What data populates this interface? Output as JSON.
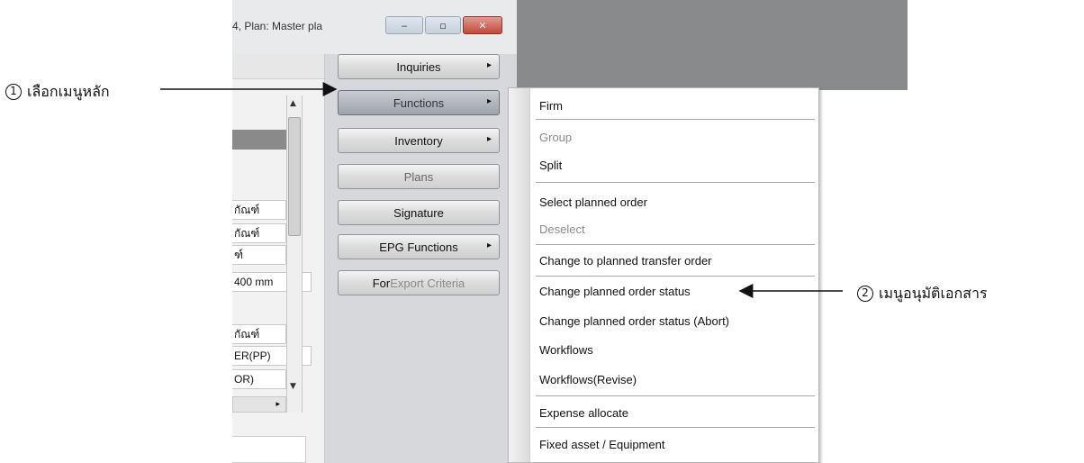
{
  "window": {
    "title": "4, Plan: Master pla",
    "controls": {
      "minimize": "‒",
      "maximize": "▫",
      "close": "✕"
    }
  },
  "left_panel": {
    "cells": [
      "กัณฑ์",
      "กัณฑ์",
      "ฑ์",
      "400 mm",
      "กัณฑ์",
      "ER(PP)",
      "OR)"
    ]
  },
  "main_menu": {
    "items": [
      {
        "label": "Inquiries",
        "has_submenu": true
      },
      {
        "label": "Functions",
        "has_submenu": true
      },
      {
        "label": "Inventory",
        "has_submenu": true
      },
      {
        "label": "Plans",
        "has_submenu": false
      },
      {
        "label": "Signature",
        "has_submenu": false
      },
      {
        "label": "EPG Functions",
        "has_submenu": true
      },
      {
        "label_a": "For ",
        "label_b": "Export Criteria",
        "has_submenu": false
      }
    ],
    "arrow": "▸"
  },
  "submenu": {
    "items": [
      {
        "label": "Firm",
        "enabled": true
      },
      {
        "label": "Group",
        "enabled": false
      },
      {
        "label": "Split",
        "enabled": true
      },
      {
        "label": "Select planned order",
        "enabled": true
      },
      {
        "label": "Deselect",
        "enabled": false
      },
      {
        "label": "Change to planned transfer order",
        "enabled": true
      },
      {
        "label": "Change planned order status",
        "enabled": true
      },
      {
        "label": "Change planned order status (Abort)",
        "enabled": true
      },
      {
        "label": "Workflows",
        "enabled": true
      },
      {
        "label": "Workflows(Revise)",
        "enabled": true
      },
      {
        "label": "Expense allocate",
        "enabled": true
      },
      {
        "label": "Fixed asset / Equipment",
        "enabled": true
      }
    ]
  },
  "annotations": {
    "step1": {
      "number": "1",
      "text": "เลือกเมนูหลัก"
    },
    "step2": {
      "number": "2",
      "text": "เมนูอนุมัติเอกสาร"
    }
  }
}
